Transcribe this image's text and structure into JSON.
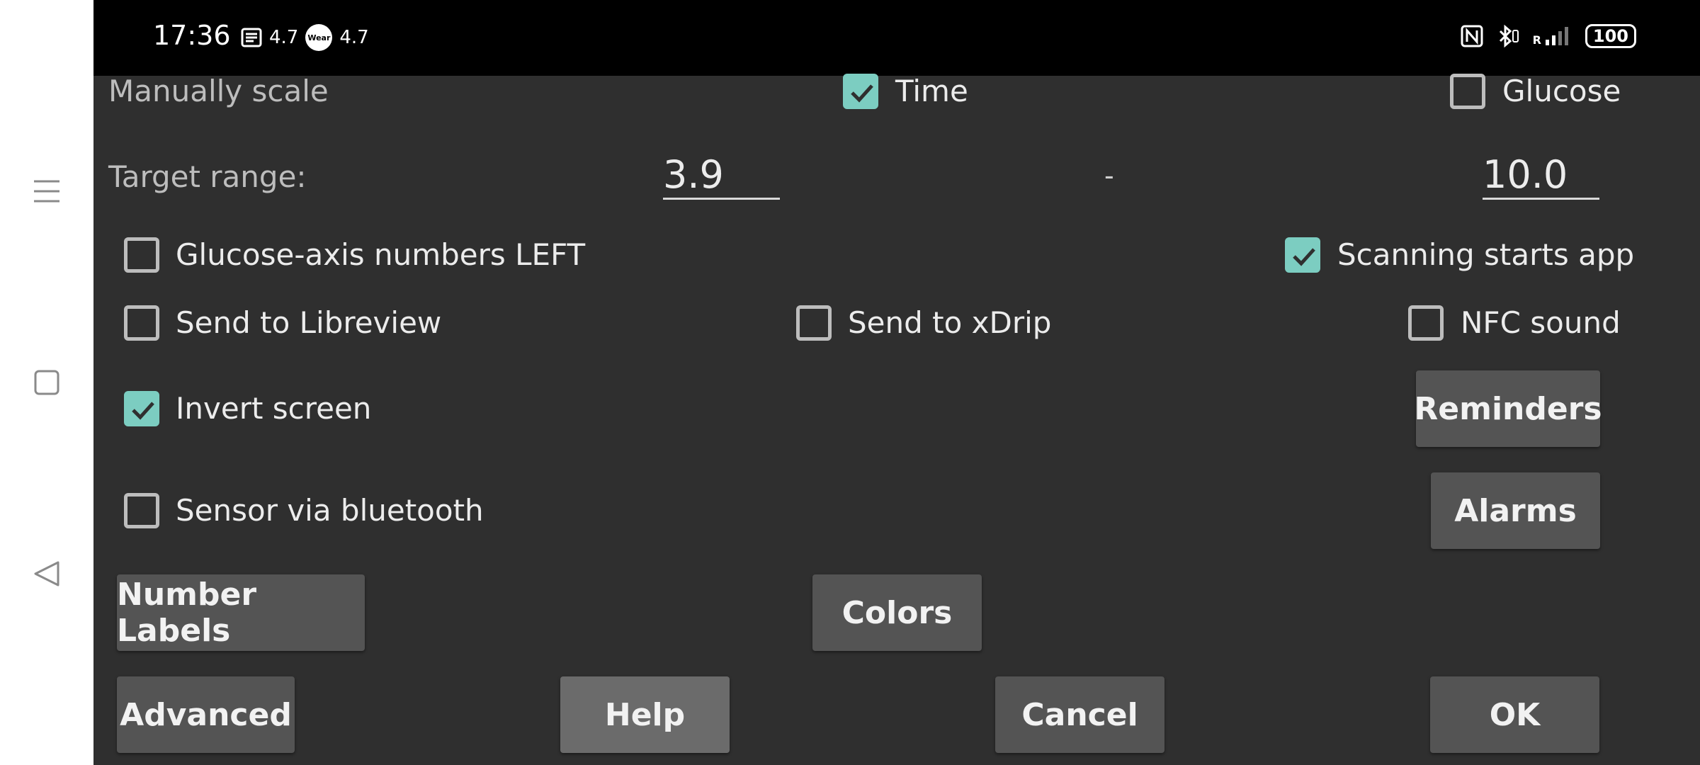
{
  "status_bar": {
    "time": "17:36",
    "left_value_1": "4.7",
    "wear_label": "Wear",
    "left_value_2": "4.7",
    "signal_label": "R",
    "battery": "100"
  },
  "settings": {
    "manual_scale_label": "Manually scale",
    "time_label": "Time",
    "glucose_label": "Glucose",
    "target_range_label": "Target range:",
    "target_low": "3.9",
    "range_separator": "-",
    "target_high": "10.0",
    "glucose_axis_left_label": "Glucose-axis numbers LEFT",
    "scanning_starts_app_label": "Scanning starts app",
    "send_libreview_label": "Send to Libreview",
    "send_xdrip_label": "Send to xDrip",
    "nfc_sound_label": "NFC sound",
    "invert_screen_label": "Invert screen",
    "sensor_bluetooth_label": "Sensor via bluetooth"
  },
  "checkbox_state": {
    "time": true,
    "glucose": false,
    "glucose_axis_left": false,
    "scanning_starts_app": true,
    "send_libreview": false,
    "send_xdrip": false,
    "nfc_sound": false,
    "invert_screen": true,
    "sensor_bluetooth": false
  },
  "buttons": {
    "reminders": "Reminders",
    "alarms": "Alarms",
    "number_labels": "Number Labels",
    "colors": "Colors",
    "advanced": "Advanced",
    "help": "Help",
    "cancel": "Cancel",
    "ok": "OK"
  },
  "colors": {
    "checkbox_checked": "#7ccdc1",
    "background": "#2f2f2f",
    "button": "#545454"
  },
  "icons": {
    "nav_menu": "menu-icon",
    "nav_home": "square-home-icon",
    "nav_back": "triangle-back-icon"
  }
}
